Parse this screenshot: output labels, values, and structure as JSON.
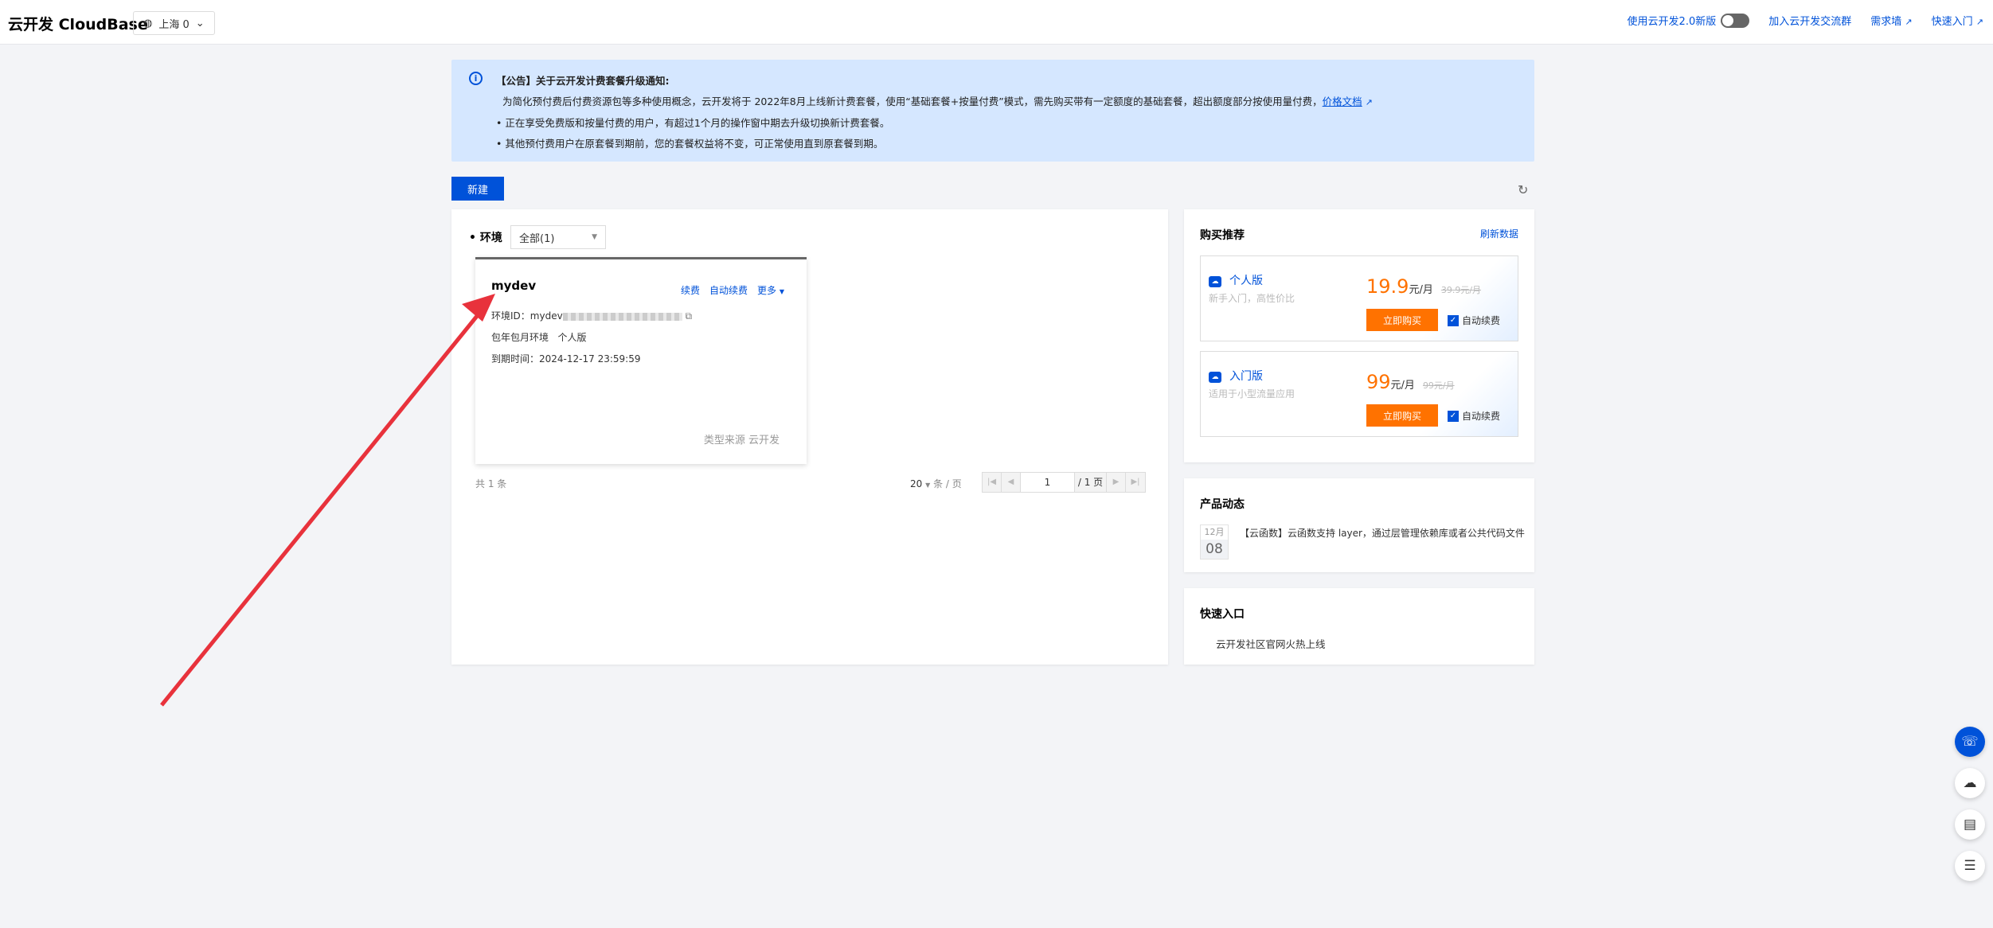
{
  "header": {
    "brand": "云开发 CloudBase",
    "region": "上海 0",
    "links": {
      "new_version": "使用云开发2.0新版",
      "join_group": "加入云开发交流群",
      "requirements": "需求墙",
      "quick_entry": "快速入门"
    }
  },
  "notice": {
    "title": "【公告】关于云开发计费套餐升级通知:",
    "paragraph": "为简化预付费后付费资源包等多种使用概念，云开发将于 2022年8月上线新计费套餐，使用“基础套餐+按量付费”模式，需先购买带有一定额度的基础套餐，超出额度部分按使用量付费，",
    "link": "价格文档",
    "bullets": [
      "正在享受免费版和按量付费的用户，有超过1个月的操作窗中期去升级切换新计费套餐。",
      "其他预付费用户在原套餐到期前，您的套餐权益将不变，可正常使用直到原套餐到期。"
    ]
  },
  "toolbar": {
    "new_label": "新建"
  },
  "env": {
    "label": "环境",
    "filter": "全部(1)",
    "card": {
      "name": "mydev",
      "actions": [
        "续费",
        "自动续费",
        "更多"
      ],
      "id_label": "环境ID：",
      "id_value": "mydev",
      "plan_label": "包年包月环境",
      "plan_value": "个人版",
      "expire_label": "到期时间：",
      "expire_value": "2024-12-17 23:59:59",
      "source": "类型来源 云开发"
    }
  },
  "pager": {
    "total": "共 1 条",
    "page_size": "20",
    "per_page": "条 / 页",
    "current": "1",
    "total_pages": "/ 1 页"
  },
  "recommend": {
    "title": "购买推荐",
    "refresh": "刷新数据",
    "plans": [
      {
        "name": "个人版",
        "desc": "新手入门，高性价比",
        "price": "19.9",
        "unit": "元/月",
        "original": "39.9元/月",
        "buy": "立即购买",
        "auto_renew": "自动续费"
      },
      {
        "name": "入门版",
        "desc": "适用于小型流量应用",
        "price": "99",
        "unit": "元/月",
        "original": "99元/月",
        "buy": "立即购买",
        "auto_renew": "自动续费"
      }
    ]
  },
  "news": {
    "title": "产品动态",
    "items": [
      {
        "month": "12月",
        "day": "08",
        "text": "【云函数】云函数支持 layer，通过层管理依赖库或者公共代码文件"
      }
    ]
  },
  "quick": {
    "title": "快速入口",
    "items": [
      "云开发社区官网火热上线"
    ]
  },
  "colors": {
    "primary": "#0052d9",
    "orange": "#ff7200",
    "annotation_arrow": "#e8323c"
  }
}
